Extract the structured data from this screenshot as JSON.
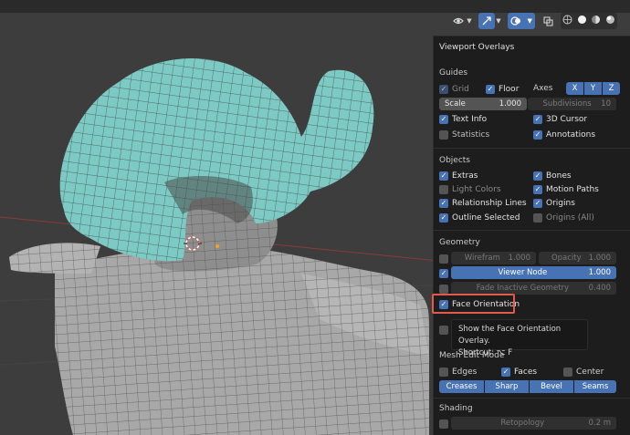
{
  "header": {
    "icons": [
      "eye-icon",
      "gizmo-icon",
      "overlays-icon",
      "xray-icon",
      "shading-icon"
    ]
  },
  "panel": {
    "title": "Viewport Overlays",
    "guides": {
      "heading": "Guides",
      "grid": "Grid",
      "floor": "Floor",
      "axes": "Axes",
      "axis_x": "X",
      "axis_y": "Y",
      "axis_z": "Z",
      "scale_label": "Scale",
      "scale_value": "1.000",
      "subdivisions_label": "Subdivisions",
      "subdivisions_value": "10",
      "text_info": "Text Info",
      "cursor_3d": "3D Cursor",
      "statistics": "Statistics",
      "annotations": "Annotations"
    },
    "objects": {
      "heading": "Objects",
      "extras": "Extras",
      "bones": "Bones",
      "light_colors": "Light Colors",
      "motion_paths": "Motion Paths",
      "relationship_lines": "Relationship Lines",
      "origins": "Origins",
      "outline_selected": "Outline Selected",
      "origins_all": "Origins (All)"
    },
    "geometry": {
      "heading": "Geometry",
      "wireframe_label": "Wirefram",
      "wireframe_value": "1.000",
      "opacity_label": "Opacity",
      "opacity_value": "1.000",
      "viewer_node_label": "Viewer Node",
      "viewer_node_value": "1.000",
      "fade_label": "Fade Inactive Geometry",
      "fade_value": "0.400",
      "face_orientation": "Face Orientation"
    },
    "tooltip": {
      "line1": "Show the Face Orientation Overlay.",
      "line2": "Shortcut: ⌥ F"
    },
    "mesh_edit": {
      "heading": "Mesh Edit Mode",
      "edges": "Edges",
      "faces": "Faces",
      "center": "Center",
      "creases": "Creases",
      "sharp": "Sharp",
      "bevel": "Bevel",
      "seams": "Seams"
    },
    "shading": {
      "heading": "Shading",
      "retopology_label": "Retopology",
      "retopology_value": "0.2 m"
    }
  },
  "colors": {
    "accent": "#4772b3",
    "highlight": "#e25a4a",
    "face_front": "#7cc9c4",
    "mesh_gray": "#a9a9a9"
  }
}
